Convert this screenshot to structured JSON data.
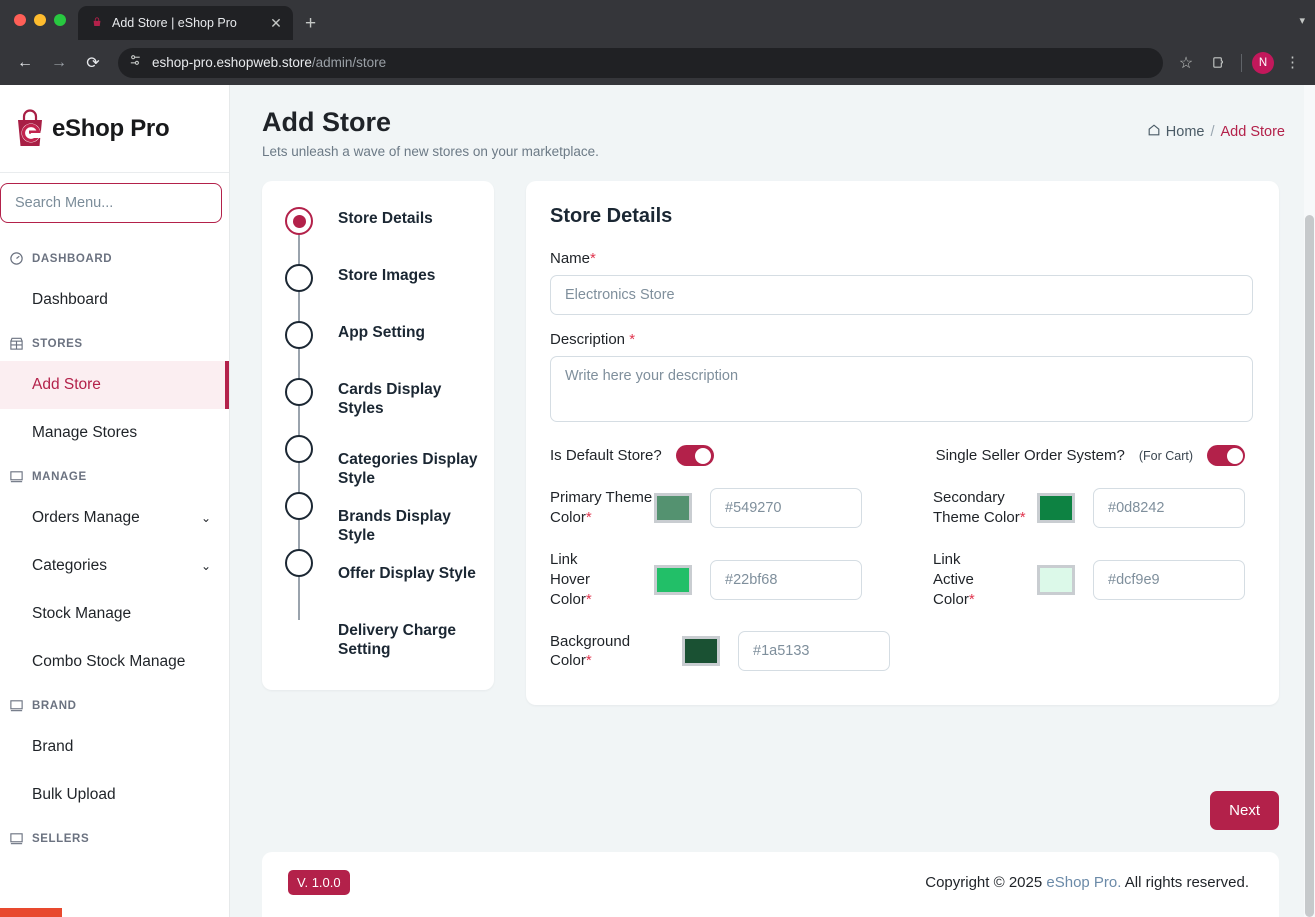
{
  "browser": {
    "tab": {
      "title": "Add Store | eShop Pro",
      "favicon": "eshop-favicon",
      "close": "✕"
    },
    "new_tab": "+",
    "tabstrip_chevron": "▾",
    "nav": {
      "back": "←",
      "forward": "→",
      "reload": "⟳"
    },
    "url": {
      "site": "eshop-pro.eshopweb.store",
      "path": "/admin/store",
      "site_icon": "site-settings-icon"
    },
    "actions": {
      "bookmark": "☆",
      "extensions": "extensions-icon",
      "profile_initial": "N",
      "menu": "⋮"
    }
  },
  "sidebar": {
    "logo": {
      "text": "eShop Pro",
      "mark": "shopping-bag-e-logo"
    },
    "search": {
      "placeholder": "Search Menu...",
      "value": ""
    },
    "sections": [
      {
        "label": "DASHBOARD",
        "icon": "gauge-icon",
        "items": [
          {
            "label": "Dashboard",
            "active": false,
            "expandable": false
          }
        ]
      },
      {
        "label": "STORES",
        "icon": "store-icon",
        "items": [
          {
            "label": "Add Store",
            "active": true,
            "expandable": false
          },
          {
            "label": "Manage Stores",
            "active": false,
            "expandable": false
          }
        ]
      },
      {
        "label": "MANAGE",
        "icon": "monitor-icon",
        "items": [
          {
            "label": "Orders Manage",
            "active": false,
            "expandable": true
          },
          {
            "label": "Categories",
            "active": false,
            "expandable": true
          },
          {
            "label": "Stock Manage",
            "active": false,
            "expandable": false
          },
          {
            "label": "Combo Stock Manage",
            "active": false,
            "expandable": false
          }
        ]
      },
      {
        "label": "BRAND",
        "icon": "monitor-icon",
        "items": [
          {
            "label": "Brand",
            "active": false,
            "expandable": false
          },
          {
            "label": "Bulk Upload",
            "active": false,
            "expandable": false
          }
        ]
      },
      {
        "label": "SELLERS",
        "icon": "monitor-icon",
        "items": []
      }
    ],
    "chevron_glyph": "⌄"
  },
  "header": {
    "title": "Add Store",
    "subtitle": "Lets unleash a wave of new stores on your marketplace.",
    "breadcrumb": {
      "home": "Home",
      "home_icon": "home-icon",
      "separator": "/",
      "current": "Add Store"
    }
  },
  "stepper": {
    "steps": [
      {
        "label": "Store Details",
        "active": true
      },
      {
        "label": "Store Images",
        "active": false
      },
      {
        "label": "App Setting",
        "active": false
      },
      {
        "label": "Cards Display Styles",
        "active": false
      },
      {
        "label": "Categories Display Style",
        "active": false
      },
      {
        "label": "Brands Display Style",
        "active": false
      },
      {
        "label": "Offer Display Style",
        "active": false
      },
      {
        "label": "Delivery Charge Setting",
        "active": false
      }
    ]
  },
  "form": {
    "title": "Store Details",
    "name": {
      "label": "Name",
      "required": "*",
      "placeholder": "Electronics Store",
      "value": ""
    },
    "description": {
      "label": "Description ",
      "required": "*",
      "placeholder": "Write here your description",
      "value": ""
    },
    "toggles": [
      {
        "label": "Is Default Store?",
        "note": "",
        "on": true
      },
      {
        "label": "Single Seller Order System?",
        "note": "(For Cart)",
        "on": true
      }
    ],
    "colors": [
      {
        "label": "Primary Theme Color",
        "required": "*",
        "placeholder": "#549270",
        "swatch": "#549270"
      },
      {
        "label": "Secondary Theme Color",
        "required": "*",
        "placeholder": "#0d8242",
        "swatch": "#0d8242"
      },
      {
        "label": "Link Hover Color",
        "required": "*",
        "placeholder": "#22bf68",
        "swatch": "#22bf68"
      },
      {
        "label": "Link Active Color",
        "required": "*",
        "placeholder": "#dcf9e9",
        "swatch": "#dcf9e9"
      },
      {
        "label": "Background Color",
        "required": "*",
        "placeholder": "#1a5133",
        "swatch": "#1a5133"
      }
    ]
  },
  "actions": {
    "next": "Next"
  },
  "footer": {
    "version": "V. 1.0.0",
    "copyright_pre": "Copyright © 2025 ",
    "brand": "eShop Pro.",
    "copyright_post": " All rights reserved."
  },
  "theme": {
    "accent": "#b3214a",
    "accent_soft": "#fbeef1",
    "page_bg": "#f1f5f6"
  }
}
